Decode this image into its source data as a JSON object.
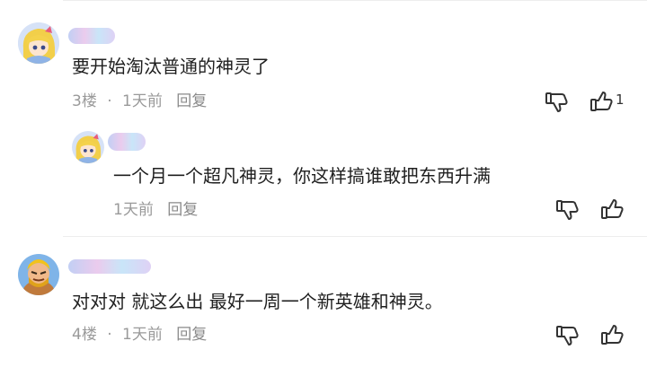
{
  "comments": [
    {
      "text": "要开始淘汰普通的神灵了",
      "floor": "3楼",
      "dot": "·",
      "time": "1天前",
      "reply_label": "回复",
      "like_count": "1",
      "replies": [
        {
          "text": "一个月一个超凡神灵，你这样搞谁敢把东西升满",
          "time": "1天前",
          "reply_label": "回复"
        }
      ]
    },
    {
      "text": "对对对 就这么出 最好一周一个新英雄和神灵。",
      "floor": "4楼",
      "dot": "·",
      "time": "1天前",
      "reply_label": "回复"
    }
  ],
  "icons": {
    "dislike": "thumbs-down-icon",
    "like": "thumbs-up-icon"
  },
  "colors": {
    "meta_text": "#9a9a9a",
    "divider": "#ededed",
    "icon": "#333333"
  }
}
